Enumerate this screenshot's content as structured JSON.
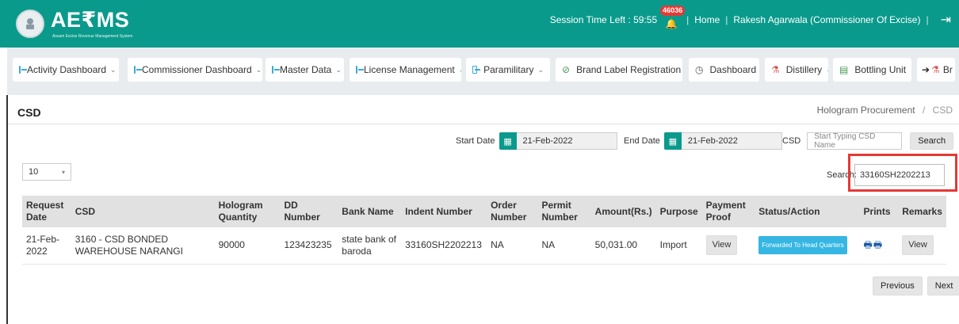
{
  "header": {
    "logo_text": "AE₹MS",
    "logo_subtext": "Assam Excise Revenue Management System",
    "session_label": "Session Time Left : 59:55",
    "notification_count": "46036",
    "home_link": "Home",
    "user_name": "Rakesh Agarwala (Commissioner Of Excise)"
  },
  "menu": {
    "items": [
      {
        "label": "Activity Dashboard",
        "icon": "dashboard-icon"
      },
      {
        "label": "Commissioner Dashboard",
        "icon": "dashboard-icon"
      },
      {
        "label": "Master Data",
        "icon": "dashboard-icon"
      },
      {
        "label": "License Management",
        "icon": "dashboard-icon"
      },
      {
        "label": "Paramilitary",
        "icon": "dashboard-icon"
      },
      {
        "label": "Brand Label Registration",
        "icon": "tag-icon"
      },
      {
        "label": "Dashboard",
        "icon": "clock-icon"
      },
      {
        "label": "Distillery",
        "icon": "flask-icon"
      },
      {
        "label": "Bottling Unit",
        "icon": "bottle-icon"
      },
      {
        "label": "Br",
        "icon": "flask-icon"
      }
    ]
  },
  "page": {
    "title": "CSD",
    "breadcrumb_parent": "Hologram Procurement",
    "breadcrumb_current": "CSD"
  },
  "filters": {
    "start_label": "Start Date",
    "start_value": "21-Feb-2022",
    "end_label": "End Date",
    "end_value": "21-Feb-2022",
    "csd_label": "CSD",
    "csd_placeholder": "Start Typing CSD Name",
    "search_button": "Search"
  },
  "table_controls": {
    "page_size": "10",
    "search_label": "Search:",
    "search_value": "33160SH2202213"
  },
  "table": {
    "headers": [
      "Request Date",
      "CSD",
      "Hologram Quantity",
      "DD Number",
      "Bank Name",
      "Indent Number",
      "Order Number",
      "Permit Number",
      "Amount(Rs.)",
      "Purpose",
      "Payment Proof",
      "Status/Action",
      "Prints",
      "Remarks"
    ],
    "rows": [
      {
        "request_date": "21-Feb-2022",
        "csd": "3160 - CSD BONDED WAREHOUSE NARANGI",
        "hologram_quantity": "90000",
        "dd_number": "123423235",
        "bank_name": "state bank of baroda",
        "indent_number": "33160SH2202213",
        "order_number": "NA",
        "permit_number": "NA",
        "amount": "50,031.00",
        "purpose": "Import",
        "payment_proof": "View",
        "status": "Forwarded To Head Quarters",
        "prints": "🖶🖶",
        "remarks": "View"
      }
    ]
  },
  "pagination": {
    "previous": "Previous",
    "next": "Next"
  }
}
